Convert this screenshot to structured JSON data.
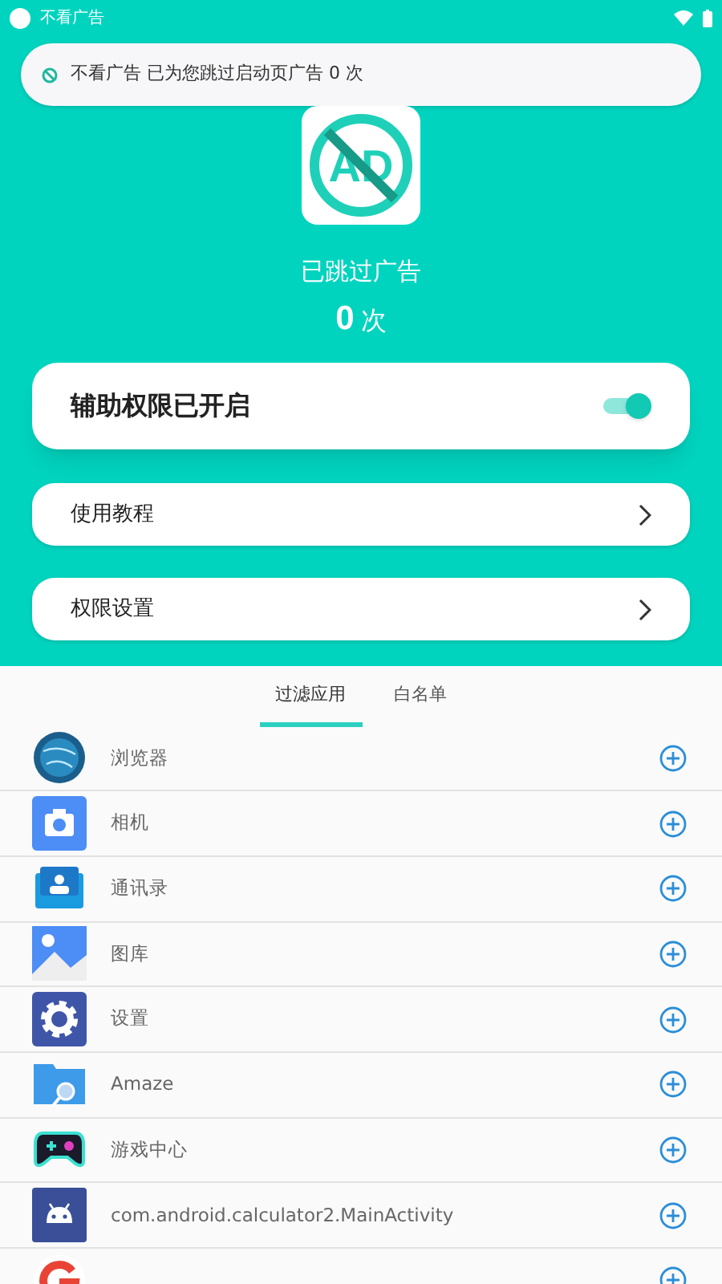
{
  "status_bar": {
    "app_name": "不看广告"
  },
  "notification": {
    "text": "不看广告 已为您跳过启动页广告 0 次"
  },
  "logo": {
    "text": "AD"
  },
  "summary": {
    "label": "已跳过广告",
    "count": "0",
    "unit": "次"
  },
  "accessibility": {
    "label": "辅助权限已开启",
    "on": true
  },
  "menu": [
    {
      "label": "使用教程"
    },
    {
      "label": "权限设置"
    }
  ],
  "tabs": [
    {
      "label": "过滤应用",
      "selected": true
    },
    {
      "label": "白名单",
      "selected": false
    }
  ],
  "apps": [
    {
      "kind": "globe",
      "name": "浏览器"
    },
    {
      "kind": "camera",
      "name": "相机"
    },
    {
      "kind": "contacts",
      "name": "通讯录"
    },
    {
      "kind": "gallery",
      "name": "图库"
    },
    {
      "kind": "settings",
      "name": "设置"
    },
    {
      "kind": "folder",
      "name": "Amaze"
    },
    {
      "kind": "gamepad",
      "name": "游戏中心"
    },
    {
      "kind": "android",
      "name": "com.android.calculator2.MainActivity"
    },
    {
      "kind": "google"
    }
  ]
}
